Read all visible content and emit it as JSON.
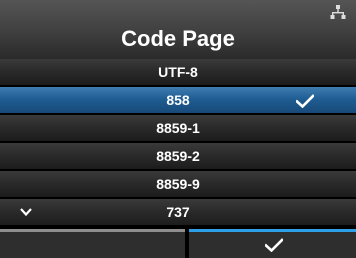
{
  "header": {
    "title": "Code Page",
    "status_icon": "network-icon"
  },
  "list": {
    "items": [
      {
        "label": "UTF-8",
        "selected": false
      },
      {
        "label": "858",
        "selected": true
      },
      {
        "label": "8859-1",
        "selected": false
      },
      {
        "label": "8859-2",
        "selected": false
      },
      {
        "label": "8859-9",
        "selected": false
      },
      {
        "label": "737",
        "selected": false
      }
    ],
    "scroll_indicator_icon": "chevron-down-icon",
    "selected_marker_icon": "checkmark-icon"
  },
  "footer": {
    "left_button_icon": "",
    "right_button_icon": "checkmark-icon"
  },
  "colors": {
    "selected_row": "#1f5d94",
    "footer_active_accent": "#2d9fe6",
    "footer_inactive_accent": "#8e8e8e"
  }
}
